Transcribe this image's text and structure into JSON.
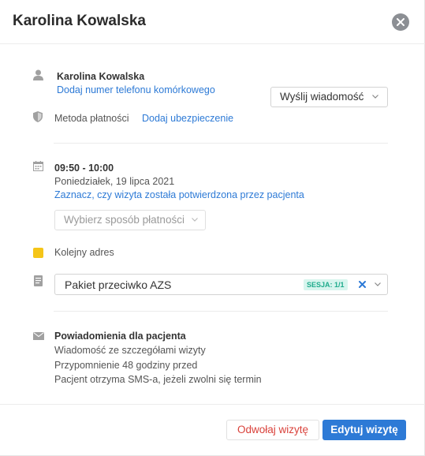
{
  "header": {
    "title": "Karolina Kowalska"
  },
  "patient": {
    "name": "Karolina Kowalska",
    "add_phone_link": "Dodaj numer telefonu komórkowego",
    "send_message_label": "Wyślij wiadomość",
    "payment_method_label": "Metoda płatności",
    "add_insurance_link": "Dodaj ubezpieczenie"
  },
  "visit": {
    "time": "09:50 - 10:00",
    "date": "Poniedziałek, 19 lipca 2021",
    "confirm_link": "Zaznacz, czy wizyta została potwierdzona przez pacjenta",
    "payment_select_placeholder": "Wybierz sposób płatności",
    "address_label": "Kolejny adres",
    "address_color": "#f5c518"
  },
  "package": {
    "name": "Pakiet przeciwko AZS",
    "session_badge": "SESJA: 1/1"
  },
  "notifications": {
    "title": "Powiadomienia dla pacjenta",
    "lines": [
      "Wiadomość ze szczegółami wizyty",
      "Przypomnienie 48 godziny przed",
      "Pacjent otrzyma SMS-a, jeżeli zwolni się termin"
    ]
  },
  "footer": {
    "cancel_label": "Odwołaj wizytę",
    "edit_label": "Edytuj wizytę"
  },
  "colors": {
    "accent": "#2d7ad6",
    "danger": "#d9413a",
    "badge_bg": "#d7f5ee",
    "badge_text": "#1eab8c"
  },
  "icons": [
    "close-icon",
    "person-icon",
    "shield-icon",
    "calendar-icon",
    "document-icon",
    "envelope-icon",
    "chevron-down-icon",
    "clear-icon"
  ]
}
